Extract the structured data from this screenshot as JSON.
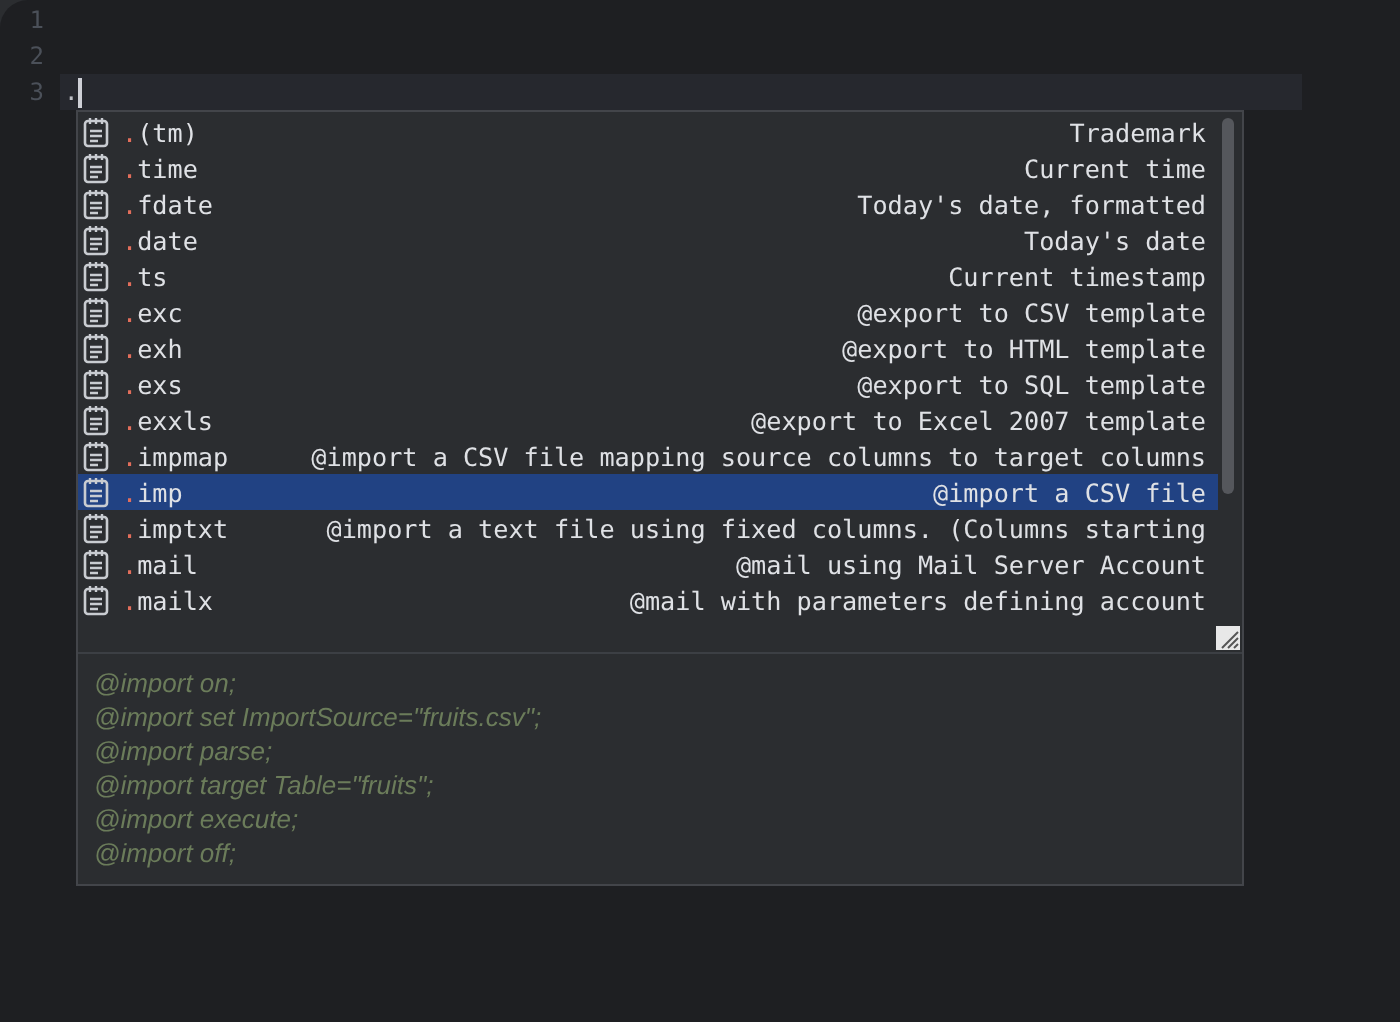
{
  "editor": {
    "lines": [
      {
        "number": "1",
        "current": false
      },
      {
        "number": "2",
        "current": false
      },
      {
        "number": "3",
        "text": ".",
        "current": true
      }
    ]
  },
  "completion": {
    "items": [
      {
        "name": ".(tm)",
        "description": "Trademark",
        "selected": false
      },
      {
        "name": ".time",
        "description": "Current time",
        "selected": false
      },
      {
        "name": ".fdate",
        "description": "Today's date, formatted",
        "selected": false
      },
      {
        "name": ".date",
        "description": "Today's date",
        "selected": false
      },
      {
        "name": ".ts",
        "description": "Current timestamp",
        "selected": false
      },
      {
        "name": ".exc",
        "description": "@export to CSV template",
        "selected": false
      },
      {
        "name": ".exh",
        "description": "@export to HTML template",
        "selected": false
      },
      {
        "name": ".exs",
        "description": "@export to SQL template",
        "selected": false
      },
      {
        "name": ".exxls",
        "description": "@export to Excel 2007 template",
        "selected": false
      },
      {
        "name": ".impmap",
        "description": "@import a CSV file mapping source columns to target columns",
        "selected": false
      },
      {
        "name": ".imp",
        "description": "@import a CSV file",
        "selected": true
      },
      {
        "name": ".imptxt",
        "description": "@import a text file using fixed columns. (Columns starting",
        "selected": false
      },
      {
        "name": ".mail",
        "description": "@mail using Mail Server Account",
        "selected": false
      },
      {
        "name": ".mailx",
        "description": "@mail with parameters defining account",
        "selected": false
      }
    ],
    "documentation": [
      "@import on;",
      "@import set ImportSource=\"fruits.csv\";",
      "@import parse;",
      "@import target Table=\"fruits\";",
      "@import execute;",
      "@import off;"
    ]
  }
}
